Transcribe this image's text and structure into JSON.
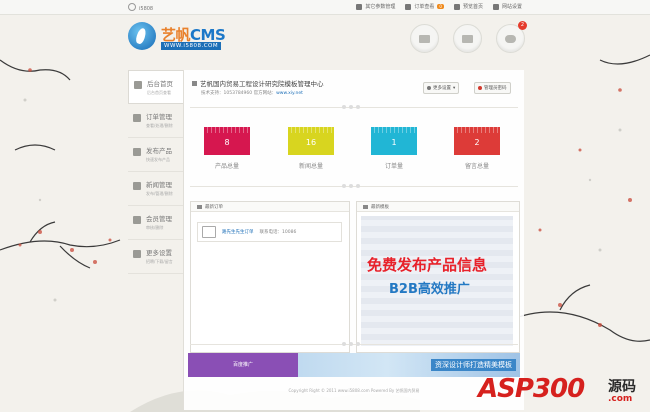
{
  "topbar": {
    "user": "i5808",
    "links": [
      {
        "label": "其它参数管理",
        "icon": "settings-icon"
      },
      {
        "label": "订单查看",
        "icon": "order-icon",
        "badge": "0"
      },
      {
        "label": "预览首页",
        "icon": "preview-icon"
      },
      {
        "label": "网站设置",
        "icon": "gear-icon"
      }
    ]
  },
  "logo": {
    "brand_cn": "艺帆",
    "brand_en": "CMS",
    "url": "WWW.i5808.COM"
  },
  "header_icons": [
    {
      "name": "users-icon"
    },
    {
      "name": "truck-icon"
    },
    {
      "name": "message-icon",
      "badge": "2"
    }
  ],
  "sidebar": {
    "items": [
      {
        "title": "后台首页",
        "sub": "后台首页查看"
      },
      {
        "title": "订单管理",
        "sub": "查看/处理/删除"
      },
      {
        "title": "发布产品",
        "sub": "快速发布产品"
      },
      {
        "title": "新闻管理",
        "sub": "发布/管理/删除"
      },
      {
        "title": "会员管理",
        "sub": "审核/删除"
      },
      {
        "title": "更多设置",
        "sub": "招聘/下载/留言"
      }
    ]
  },
  "info": {
    "line1": "艺帆国内贸易工程设计研究院模板管理中心",
    "support_label": "技术支持：",
    "support_phone": "1053784960",
    "site_label": "官方网站：",
    "site": "www.xiy.net"
  },
  "info_buttons": {
    "more": "更多设置",
    "password": "管理员密码"
  },
  "stats": [
    {
      "value": "8",
      "label": "产品总量",
      "color": "#d6174f"
    },
    {
      "value": "16",
      "label": "新闻总量",
      "color": "#d8d51f"
    },
    {
      "value": "1",
      "label": "订单量",
      "color": "#21b6d5"
    },
    {
      "value": "2",
      "label": "留言总量",
      "color": "#dd3b38"
    }
  ],
  "orders_box": {
    "title": "最新订单",
    "order": {
      "name": "路先生先生订单",
      "phone_label": "联系电话：",
      "phone": "10086"
    }
  },
  "promo_box": {
    "title": "最新模板",
    "line1": "免费发布产品信息",
    "line2": "B2B高效推广"
  },
  "banner": {
    "left": "百度推广",
    "right": "资深设计师打造精美模板"
  },
  "footer": "Copyright Right © 2011 www.i5808.com Powered By 艺帆国内贸易",
  "watermark": {
    "t1": "ASP300",
    "t2": "源码",
    "t3": ".com"
  }
}
